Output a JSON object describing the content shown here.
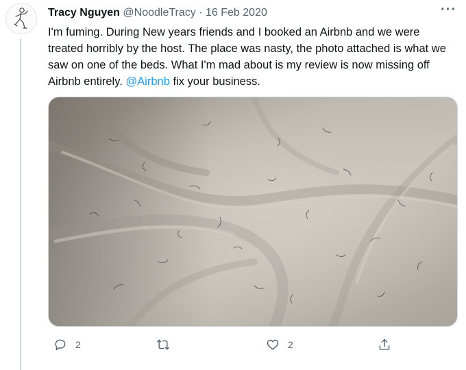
{
  "tweet": {
    "author_name": "Tracy Nguyen",
    "author_handle": "@NoodleTracy",
    "separator": "·",
    "date": "16 Feb 2020",
    "more_label": "···",
    "text_before_mention": "I'm fuming. During New years friends and I booked an Airbnb and we were treated horribly by the host. The place was nasty, the photo attached is what we saw on one of the beds. What I'm mad about is my review is now missing off Airbnb entirely. ",
    "mention": "@Airbnb",
    "text_after_mention": " fix your business.",
    "media_icon": "photo-of-bed-sheet-with-hairs"
  },
  "actions": {
    "reply": {
      "icon": "reply-icon",
      "count": "2"
    },
    "retweet": {
      "icon": "retweet-icon",
      "count": ""
    },
    "like": {
      "icon": "heart-icon",
      "count": "2"
    },
    "share": {
      "icon": "share-icon"
    }
  },
  "colors": {
    "text": "#0f1419",
    "secondary": "#536471",
    "link": "#1d9bf0",
    "border": "#cfd9de"
  }
}
